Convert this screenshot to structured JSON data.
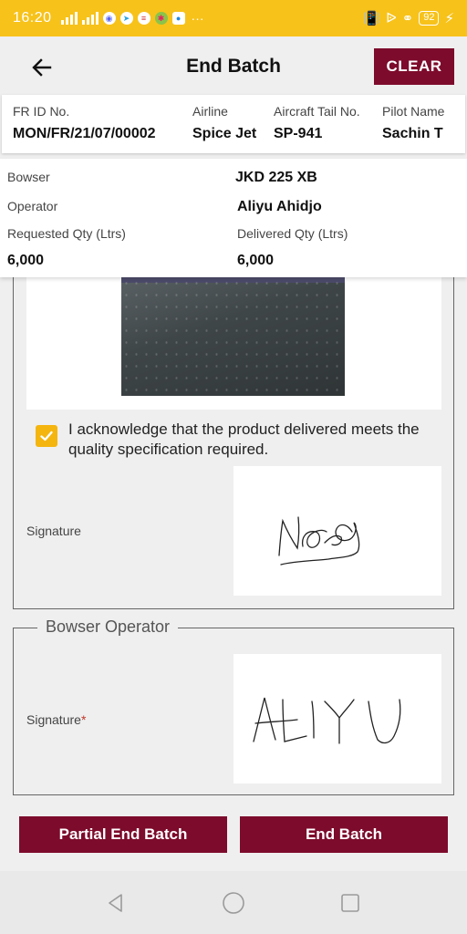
{
  "status_bar": {
    "time": "16:20",
    "battery": "92",
    "more": "···"
  },
  "header": {
    "title": "End Batch",
    "clear_label": "CLEAR"
  },
  "flight_info": {
    "fr_id_label": "FR ID No.",
    "fr_id_value": "MON/FR/21/07/00002",
    "airline_label": "Airline",
    "airline_value": "Spice Jet",
    "tail_label": "Aircraft Tail No.",
    "tail_value": "SP-941",
    "pilot_label": "Pilot Name",
    "pilot_value": "Sachin T"
  },
  "batch_info": {
    "bowser_label": "Bowser",
    "bowser_value": "JKD 225 XB",
    "operator_label": "Operator",
    "operator_value": "Aliyu Ahidjo",
    "requested_label": "Requested Qty (Ltrs)",
    "requested_value": "6,000",
    "delivered_label": "Delivered Qty (Ltrs)",
    "delivered_value": "6,000"
  },
  "quality": {
    "acknowledge_text": "I acknowledge that the product delivered meets the quality specification required.",
    "acknowledged": true,
    "signature_label": "Signature"
  },
  "bowser_operator": {
    "legend": "Bowser Operator",
    "signature_label": "Signature",
    "required_mark": "*"
  },
  "actions": {
    "partial_end_label": "Partial End Batch",
    "end_label": "End Batch"
  },
  "colors": {
    "status_bar": "#f7c21a",
    "primary": "#7d0b2c",
    "checkbox": "#f5b50f"
  },
  "icons": {
    "back": "arrow-left-icon",
    "check": "check-icon",
    "nav_back": "triangle-back-icon",
    "nav_home": "circle-home-icon",
    "nav_recent": "square-recent-icon"
  }
}
